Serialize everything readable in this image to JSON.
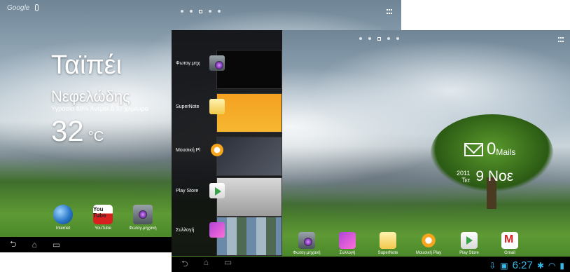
{
  "back_screen": {
    "google_label": "Google",
    "weather": {
      "city": "Ταϊπέι",
      "condition": "Νεφελώδης",
      "detail": "Υγρασία 88% Άνεμοι Δ 37 χλμ/ώρα",
      "temperature": "32",
      "unit": "°C"
    },
    "dock": [
      {
        "label": "Internet",
        "icon": "globe-icon"
      },
      {
        "label": "YouTube",
        "icon": "youtube-icon"
      },
      {
        "label": "Φωτογ.μηχανή",
        "icon": "camera-icon"
      }
    ],
    "youtube_text": "You Tube"
  },
  "recent_apps": [
    {
      "label": "Φωτογ.μηχ",
      "icon": "camera-icon"
    },
    {
      "label": "SuperNote",
      "icon": "supernote-icon"
    },
    {
      "label": "Μουσική Pl",
      "icon": "music-icon"
    },
    {
      "label": "Play Store",
      "icon": "play-store-icon"
    },
    {
      "label": "Συλλογή",
      "icon": "gallery-icon"
    }
  ],
  "front_screen": {
    "mail_count": "0",
    "mail_label": "Mails",
    "year": "2011",
    "weekday": "Τετ",
    "day_month": "9 Νοε",
    "dock": [
      {
        "label": "Φωτογ.μηχανή",
        "icon": "camera-icon"
      },
      {
        "label": "Συλλογή",
        "icon": "gallery-icon"
      },
      {
        "label": "SuperNote",
        "icon": "supernote-icon"
      },
      {
        "label": "Μουσική Play",
        "icon": "music-icon"
      },
      {
        "label": "Play Store",
        "icon": "play-store-icon"
      },
      {
        "label": "Gmail",
        "icon": "gmail-icon"
      }
    ],
    "clock": "6:27"
  },
  "nav_glyphs": {
    "back": "⮌",
    "home": "⌂",
    "recent": "▭"
  }
}
